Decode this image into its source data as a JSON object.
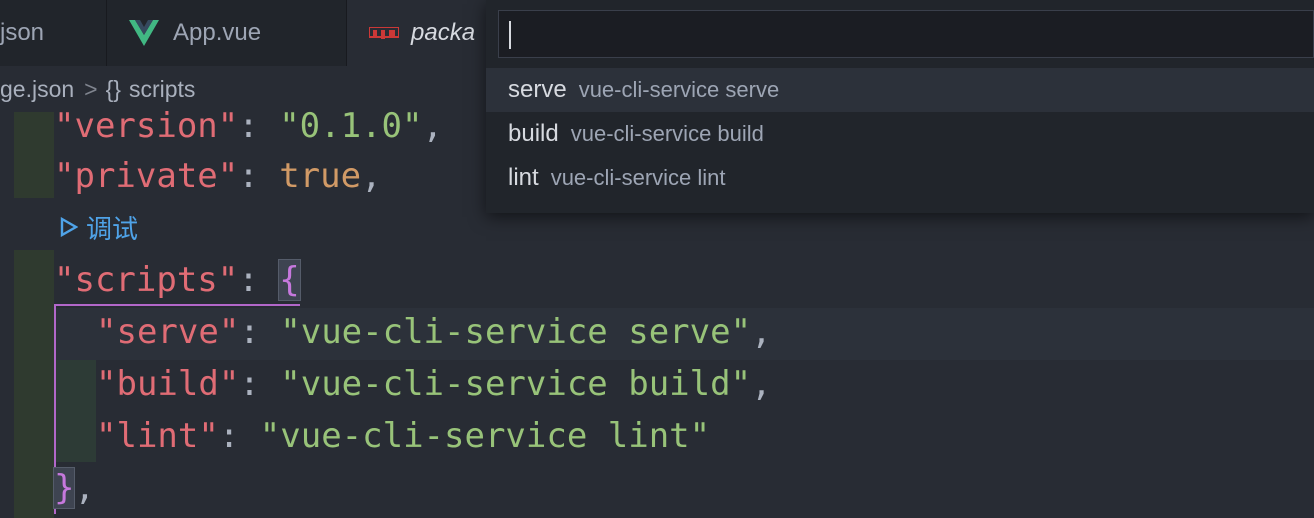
{
  "tabs": [
    {
      "label": "json"
    },
    {
      "label": "App.vue",
      "icon": "vue-icon"
    },
    {
      "label": "packa",
      "icon": "npm-icon"
    }
  ],
  "breadcrumb": {
    "file": "ge.json",
    "separator": ">",
    "symbol_icon": "{}",
    "symbol": "scripts"
  },
  "editor": {
    "lines": [
      {
        "key": "\"version\"",
        "colon": ": ",
        "value": "\"0.1.0\"",
        "end": ","
      },
      {
        "key": "\"private\"",
        "colon": ": ",
        "value": "true",
        "end": ","
      },
      {
        "key": "\"scripts\"",
        "colon": ": ",
        "open": "{"
      },
      {
        "key": "\"serve\"",
        "colon": ": ",
        "value": "\"vue-cli-service serve\"",
        "end": ","
      },
      {
        "key": "\"build\"",
        "colon": ": ",
        "value": "\"vue-cli-service build\"",
        "end": ","
      },
      {
        "key": "\"lint\"",
        "colon": ": ",
        "value": "\"vue-cli-service lint\""
      },
      {
        "close": "}",
        "end": ","
      }
    ],
    "codelens": "调试"
  },
  "quickpick": {
    "input_value": "",
    "items": [
      {
        "label": "serve",
        "description": "vue-cli-service serve"
      },
      {
        "label": "build",
        "description": "vue-cli-service build"
      },
      {
        "label": "lint",
        "description": "vue-cli-service lint"
      }
    ]
  },
  "colors": {
    "background": "#282c34",
    "key": "#e06c75",
    "string": "#98c379",
    "boolean": "#d19a66",
    "bracket": "#c678dd",
    "codelens": "#4fa3e8"
  }
}
